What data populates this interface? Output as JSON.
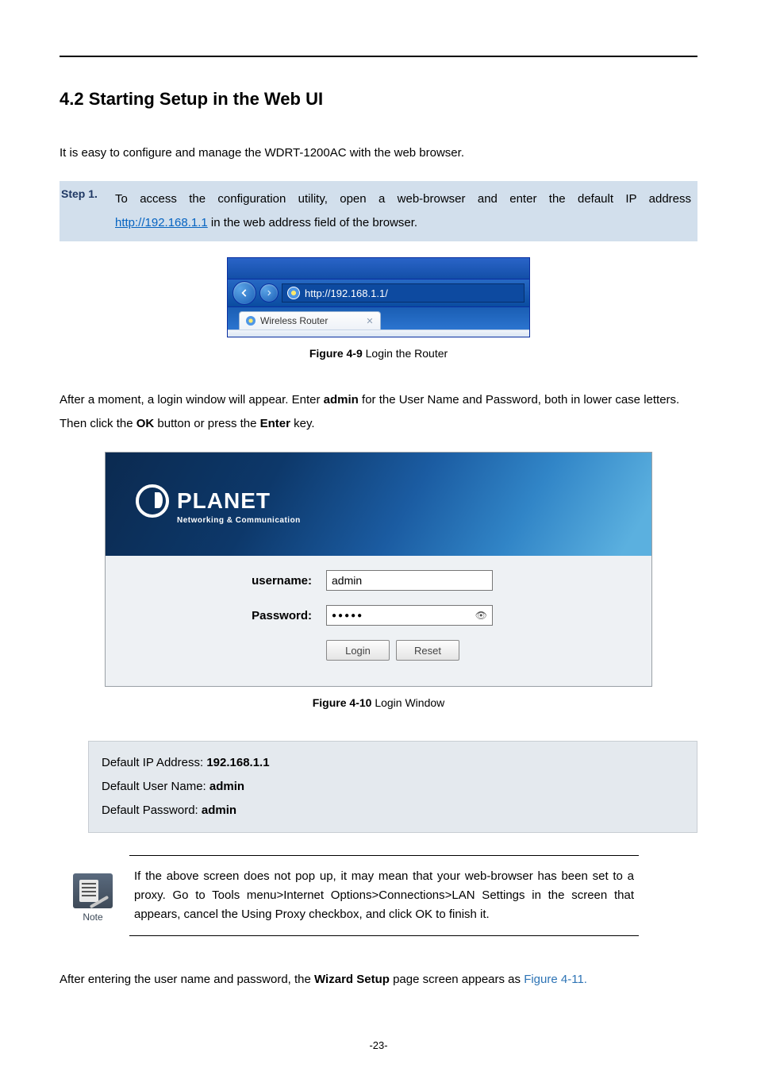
{
  "heading": "4.2  Starting Setup in the Web UI",
  "intro": "It is easy to configure and manage the WDRT-1200AC with the web browser.",
  "step": {
    "label": "Step 1.",
    "text_before": "To access the configuration utility, open a web-browser and enter the default IP address ",
    "url": "http://192.168.1.1",
    "text_after": " in the web address field of the browser."
  },
  "browser": {
    "url": "http://192.168.1.1/",
    "tab_title": "Wireless Router"
  },
  "fig1_label": "Figure 4-9",
  "fig1_text": " Login the Router",
  "after_para_1a": "After a moment, a login window will appear. Enter ",
  "after_para_1_admin": "admin",
  "after_para_1b": " for the User Name and Password, both in lower case letters. Then click the ",
  "after_para_1_ok": "OK",
  "after_para_1c": " button or press the ",
  "after_para_1_enter": "Enter",
  "after_para_1d": " key.",
  "login": {
    "brand_main": "PLANET",
    "brand_sub": "Networking & Communication",
    "username_label": "username:",
    "username_value": "admin",
    "password_label": "Password:",
    "password_mask": "●●●●●",
    "login_btn": "Login",
    "reset_btn": "Reset"
  },
  "fig2_label": "Figure 4-10",
  "fig2_text": " Login Window",
  "defaults": {
    "ip_label": "Default IP Address: ",
    "ip_value": "192.168.1.1",
    "user_label": "Default User Name: ",
    "user_value": "admin",
    "pw_label": "Default Password: ",
    "pw_value": "admin"
  },
  "note": {
    "icon_label": "Note",
    "text": "If the above screen does not pop up, it may mean that your web-browser has been set to a proxy. Go to Tools menu>Internet Options>Connections>LAN Settings in the screen that appears, cancel the Using Proxy checkbox, and click OK to finish it."
  },
  "closing_a": "After entering the user name and password, the ",
  "closing_bold": "Wizard Setup",
  "closing_b": " page screen appears as ",
  "closing_link": "Figure 4-11.",
  "page_number": "-23-"
}
